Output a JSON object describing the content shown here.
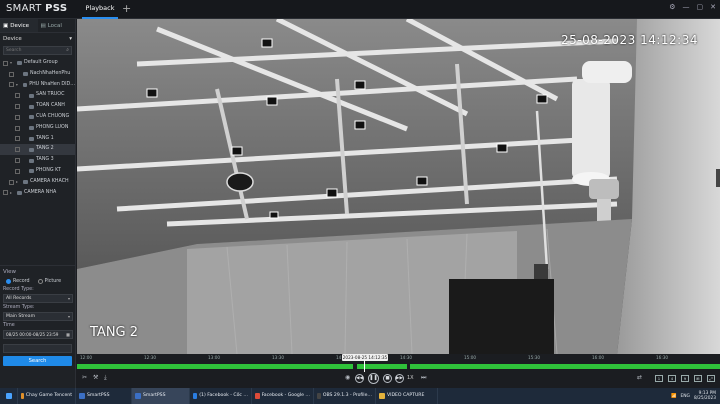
{
  "app": {
    "title_light": "SMART",
    "title_bold": "PSS"
  },
  "tabs": {
    "playback": "Playback",
    "add": "+"
  },
  "window": {
    "settings": "⚙",
    "minimize": "—",
    "maximize": "▢",
    "close": "✕"
  },
  "left_panel": {
    "tab_device": "Device",
    "tab_local": "Local",
    "device_label": "Device",
    "search_placeholder": "Search",
    "tree": [
      {
        "label": "Default Group",
        "level": 0,
        "arrow": "▾"
      },
      {
        "label": "NachNhaHenPhu",
        "level": 1,
        "arrow": ""
      },
      {
        "label": "PHU NhaHen DID…",
        "level": 1,
        "arrow": "▾"
      },
      {
        "label": "SAN TRUOC",
        "level": 2,
        "arrow": ""
      },
      {
        "label": "TOAN CANH",
        "level": 2,
        "arrow": ""
      },
      {
        "label": "CUA CHUONG",
        "level": 2,
        "arrow": ""
      },
      {
        "label": "PHONG LUON",
        "level": 2,
        "arrow": ""
      },
      {
        "label": "TANG 1",
        "level": 2,
        "arrow": ""
      },
      {
        "label": "TANG 2",
        "level": 2,
        "arrow": "",
        "selected": true
      },
      {
        "label": "TANG 3",
        "level": 2,
        "arrow": ""
      },
      {
        "label": "PHONG KT",
        "level": 2,
        "arrow": ""
      },
      {
        "label": "CAMERA KHACH",
        "level": 1,
        "arrow": "▸"
      },
      {
        "label": "CAMERA NHA",
        "level": 0,
        "arrow": "▸"
      }
    ],
    "view_label": "View",
    "record_label": "Record",
    "picture_label": "Picture",
    "record_type_label": "Record Type:",
    "record_type_value": "All Records",
    "stream_type_label": "Stream Type:",
    "stream_type_value": "Main Stream",
    "time_label": "Time",
    "time_value": "08/25 00:00-08/25 23:59",
    "search_button": "Search"
  },
  "video": {
    "osd_time": "25-08-2023 14:12:34",
    "osd_name": "TANG 2"
  },
  "timeline": {
    "ticks": [
      "12:00",
      "12:30",
      "13:00",
      "13:30",
      "14:00",
      "14:30",
      "15:00",
      "15:30",
      "16:00",
      "16:30"
    ],
    "cursor_label": "2023-08-25 14:12:35",
    "speed": "1X"
  },
  "taskbar": {
    "items": [
      {
        "label": "Chay Game Tencent",
        "color": "#e0902a"
      },
      {
        "label": "SmartPSS",
        "color": "#3b6fc4"
      },
      {
        "label": "SmartPSS",
        "color": "#3b6fc4",
        "active": true
      },
      {
        "label": "(1) Facebook - Cốc …",
        "color": "#2a7de1"
      },
      {
        "label": "Facebook - Google …",
        "color": "#dd4b39"
      },
      {
        "label": "OBS 29.1.3 - Profile…",
        "color": "#444"
      },
      {
        "label": "VIDEO CAPTURE",
        "color": "#e3b23c"
      }
    ],
    "lang": "ENG",
    "time": "9:13 PM",
    "date": "8/25/2023"
  }
}
